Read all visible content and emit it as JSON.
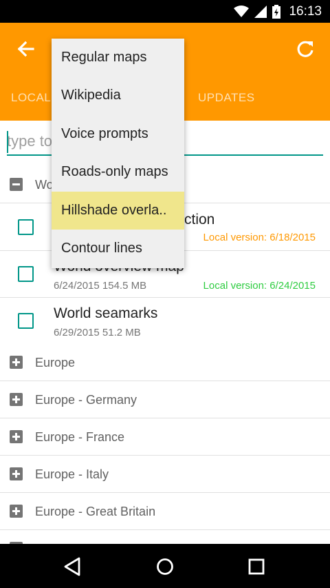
{
  "status_bar": {
    "time": "16:13",
    "icons": [
      "wifi-icon",
      "cell-signal-icon",
      "battery-icon"
    ]
  },
  "toolbar": {
    "icons": [
      "back-arrow-icon",
      "refresh-icon"
    ]
  },
  "tabs": [
    {
      "label": "LOCAL"
    },
    {
      "label": "UPDATES"
    }
  ],
  "search": {
    "placeholder": "type to"
  },
  "groups": {
    "expanded": {
      "label": "Wo"
    },
    "collapsed": [
      {
        "label": "Europe"
      },
      {
        "label": "Europe - Germany"
      },
      {
        "label": "Europe - France"
      },
      {
        "label": "Europe - Italy"
      },
      {
        "label": "Europe - Great Britain"
      }
    ]
  },
  "items": [
    {
      "name": "ction",
      "details": "",
      "version": "Local version: 6/18/2015",
      "version_color": "#ff9800"
    },
    {
      "name": "World overview map",
      "details": "6/24/2015 154.5 MB",
      "version": "Local version: 6/24/2015",
      "version_color": "#2ecc40"
    },
    {
      "name": "World seamarks",
      "details": "6/29/2015 51.2 MB",
      "version": ""
    }
  ],
  "menu": {
    "items": [
      {
        "label": "Regular maps"
      },
      {
        "label": "Wikipedia"
      },
      {
        "label": "Voice prompts"
      },
      {
        "label": "Roads-only maps"
      },
      {
        "label": "Hillshade overla..",
        "highlighted": true
      },
      {
        "label": "Contour lines"
      }
    ]
  },
  "colors": {
    "accent": "#ff9800",
    "teal": "#009688",
    "highlight": "#f0e68c",
    "green": "#2ecc40"
  },
  "nav_bar": {
    "icons": [
      "back-triangle-icon",
      "home-circle-icon",
      "recents-square-icon"
    ]
  }
}
